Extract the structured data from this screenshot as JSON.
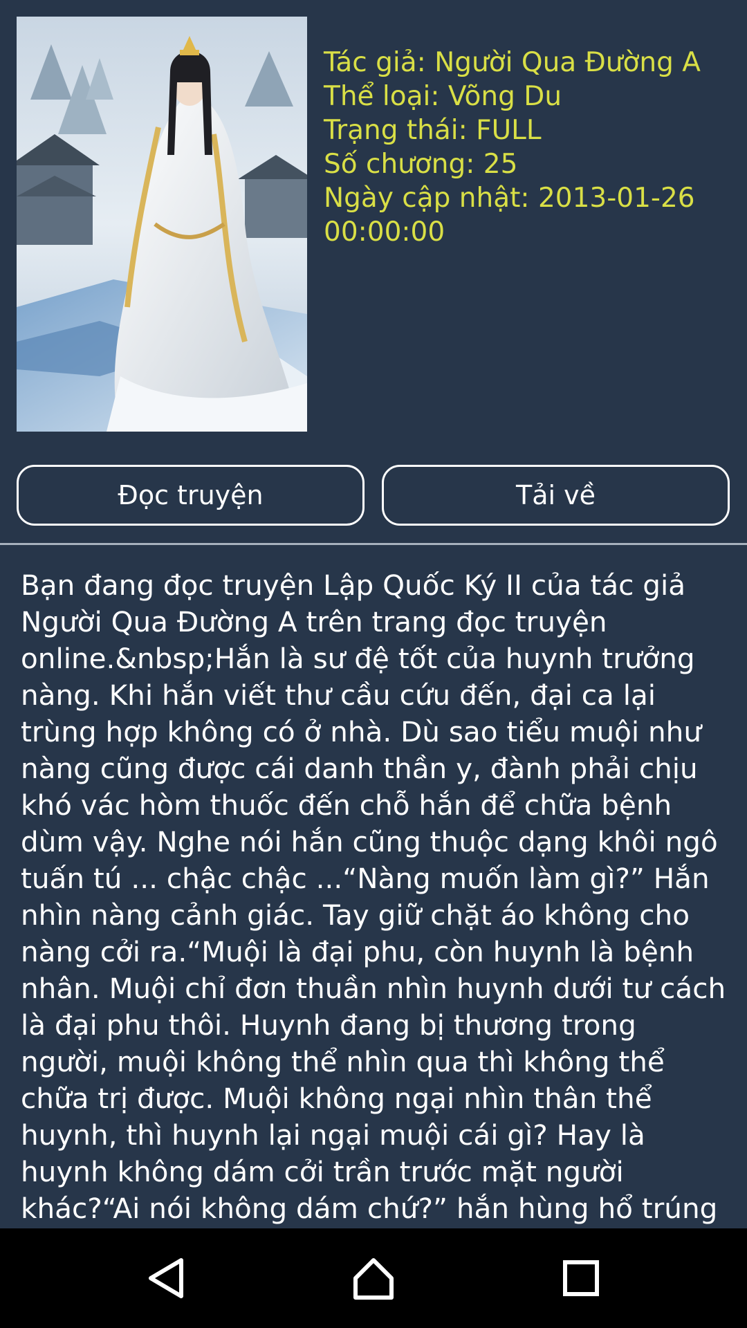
{
  "book_info": {
    "author": "Tác giả: Người Qua Đường A",
    "genre": "Thể loại: Võng Du",
    "status": "Trạng thái: FULL",
    "chapters": "Số chương: 25",
    "updated": "Ngày cập nhật: 2013-01-26 00:00:00"
  },
  "actions": {
    "read_label": "Đọc truyện",
    "download_label": "Tải về"
  },
  "description": "Bạn đang đọc truyện Lập Quốc Ký II của tác giả Người Qua Đường A trên trang đọc truyện online.&nbsp;Hắn là sư đệ tốt của huynh trưởng nàng. Khi hắn viết thư cầu cứu đến, đại ca lại trùng hợp không có ở nhà. Dù sao tiểu muội như nàng cũng được cái danh thần y, đành phải chịu khó vác hòm thuốc đến chỗ hắn để chữa bệnh dùm vậy. Nghe nói hắn cũng thuộc dạng khôi ngô tuấn tú ... chậc chậc ...“Nàng muốn làm gì?” Hắn nhìn nàng cảnh giác. Tay giữ chặt áo không cho nàng cởi ra.“Muội là đại phu, còn huynh là bệnh nhân. Muội chỉ đơn thuần nhìn huynh dưới tư cách là đại phu thôi. Huynh đang bị thương trong người, muội không thể nhìn qua thì không thể chữa trị được. Muội không ngại nhìn thân thể huynh, thì huynh lại ngại muội cái gì? Hay là huynh không dám cởi trần trước mặt người khác?“Ai nói không dám chứ?” hắn hùng hổ trúng ngay kế kích tướng.Sắc lang nữ",
  "colors": {
    "background": "#27364a",
    "info_text": "#d9df46",
    "text": "#ffffff",
    "nav_bar": "#000000"
  },
  "icons": {
    "nav_back": "back-triangle-icon",
    "nav_home": "home-icon",
    "nav_recent": "recent-apps-icon"
  }
}
